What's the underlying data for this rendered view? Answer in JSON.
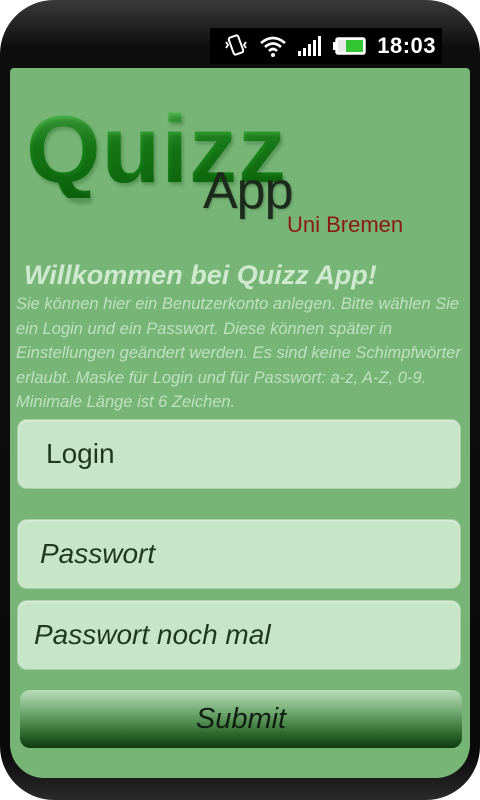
{
  "status_bar": {
    "time": "18:03",
    "icons": [
      "vibrate-icon",
      "wifi-icon",
      "signal-icon",
      "battery-icon"
    ]
  },
  "logo": {
    "quizz": "Quizz",
    "app": "App",
    "uni": "Uni Bremen"
  },
  "welcome": "Willkommen bei Quizz App!",
  "info_text": "Sie können hier ein Benutzerkonto anlegen. Bitte wählen Sie ein Login und ein Passwort. Diese können später in Einstellungen geändert werden. Es sind keine Schimpfwörter erlaubt. Maske für Login und für Passwort: a-z, A-Z, 0-9. Minimale Länge ist 6 Zeichen.",
  "form": {
    "login_placeholder": "Login",
    "password_placeholder": "Passwort",
    "password_repeat_placeholder": "Passwort noch mal",
    "submit_label": "Submit"
  },
  "colors": {
    "background": "#76b576",
    "field": "#c7e5c7",
    "logo_green": "#1f8f1f",
    "uni_red": "#8a1a12"
  }
}
